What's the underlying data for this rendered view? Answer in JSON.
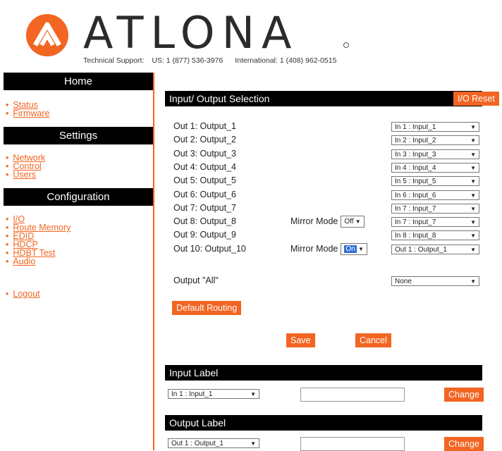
{
  "header": {
    "brand": "ATLONA",
    "support_label": "Technical Support:",
    "support_us": "US: 1 (877) 536-3976",
    "support_intl": "International: 1 (408) 962-0515"
  },
  "sidebar": {
    "home_title": "Home",
    "home_items": [
      "Status",
      "Firmware"
    ],
    "settings_title": "Settings",
    "settings_items": [
      "Network",
      "Control",
      "Users"
    ],
    "config_title": "Configuration",
    "config_items": [
      "I/O",
      "Route Memory",
      "EDID",
      "HDCP",
      "HDBT Test",
      "Audio"
    ],
    "logout": "Logout"
  },
  "io": {
    "title": "Input/ Output Selection",
    "reset": "I/O Reset",
    "mirror_label": "Mirror Mode",
    "outputs": [
      {
        "label": "Out 1: Output_1",
        "select": "In 1 : Input_1"
      },
      {
        "label": "Out 2: Output_2",
        "select": "In 2 : Input_2"
      },
      {
        "label": "Out 3: Output_3",
        "select": "In 3 : Input_3"
      },
      {
        "label": "Out 4: Output_4",
        "select": "In 4 : Input_4"
      },
      {
        "label": "Out 5: Output_5",
        "select": "In 5 : Input_5"
      },
      {
        "label": "Out 6: Output_6",
        "select": "In 6 : Input_6"
      },
      {
        "label": "Out 7: Output_7",
        "select": "In 7 : Input_7"
      },
      {
        "label": "Out 8: Output_8",
        "select": "In 7 : Input_7",
        "mirror": "Off"
      },
      {
        "label": "Out 9: Output_9",
        "select": "In 8 : Input_8"
      },
      {
        "label": "Out 10: Output_10",
        "select": "Out 1 : Output_1",
        "mirror": "On"
      }
    ],
    "all_label": "Output \"All\"",
    "all_select": "None",
    "default_routing": "Default Routing",
    "save": "Save",
    "cancel": "Cancel"
  },
  "input_label": {
    "title": "Input Label",
    "select": "In 1 : Input_1",
    "value": "",
    "change": "Change"
  },
  "output_label": {
    "title": "Output Label",
    "select": "Out 1 : Output_1",
    "value": "",
    "change": "Change"
  },
  "colors": {
    "accent": "#f26522",
    "bar": "#000000",
    "selected": "#2f6ed6"
  }
}
